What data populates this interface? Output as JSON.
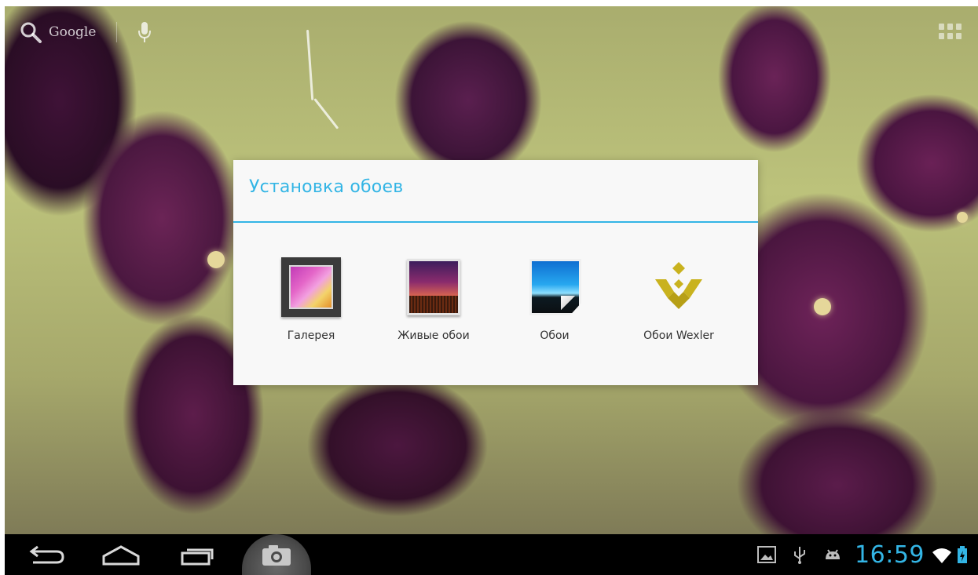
{
  "search_bar": {
    "label": "Google",
    "search_icon": "search-icon",
    "mic_icon": "mic-icon"
  },
  "launcher": {
    "apps_icon": "all-apps-icon"
  },
  "dialog": {
    "title": "Установка обоев",
    "accent_color": "#33b5e5",
    "options": [
      {
        "label": "Галерея",
        "icon": "gallery-icon"
      },
      {
        "label": "Живые обои",
        "icon": "live-wallpapers-icon"
      },
      {
        "label": "Обои",
        "icon": "wallpapers-icon"
      },
      {
        "label": "Обои Wexler",
        "icon": "wexler-wallpapers-icon"
      }
    ]
  },
  "navbar": {
    "buttons": [
      {
        "icon": "back-icon"
      },
      {
        "icon": "home-icon"
      },
      {
        "icon": "recent-apps-icon"
      },
      {
        "icon": "camera-icon"
      }
    ],
    "status": {
      "time": "16:59",
      "icons": [
        "gallery-notification-icon",
        "usb-icon",
        "android-debug-icon",
        "wifi-icon",
        "battery-icon"
      ],
      "clock_color": "#33b5e5"
    }
  }
}
